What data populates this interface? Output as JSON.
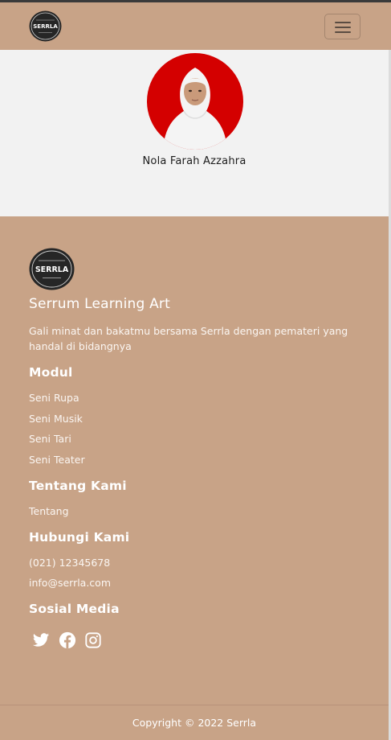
{
  "navbar": {
    "logo_text": "SERRLA",
    "logo_small_top": "Interaksi Pembelajaran",
    "logo_small_bottom": "Seni Budaya",
    "menu_toggle_icon": "hamburger-icon"
  },
  "profile": {
    "name": "Nola Farah Azzahra"
  },
  "footer": {
    "logo_text": "SERRLA",
    "brand": "Serrum Learning Art",
    "tagline": "Gali minat dan bakatmu bersama Serrla dengan pemateri yang handal di bidangnya",
    "modul": {
      "title": "Modul",
      "items": [
        "Seni Rupa",
        "Seni Musik",
        "Seni Tari",
        "Seni Teater"
      ]
    },
    "tentang": {
      "title": "Tentang Kami",
      "items": [
        "Tentang"
      ]
    },
    "hubungi": {
      "title": "Hubungi Kami",
      "phone": "(021) 12345678",
      "email": "info@serrla.com"
    },
    "sosial": {
      "title": "Sosial Media",
      "icons": [
        "twitter-icon",
        "facebook-icon",
        "instagram-icon"
      ]
    },
    "copyright": "Copyright © 2022 Serrla"
  },
  "colors": {
    "brand_tan": "#c8a387",
    "page_bg": "#f2f2f2",
    "avatar_bg": "#d40000"
  }
}
